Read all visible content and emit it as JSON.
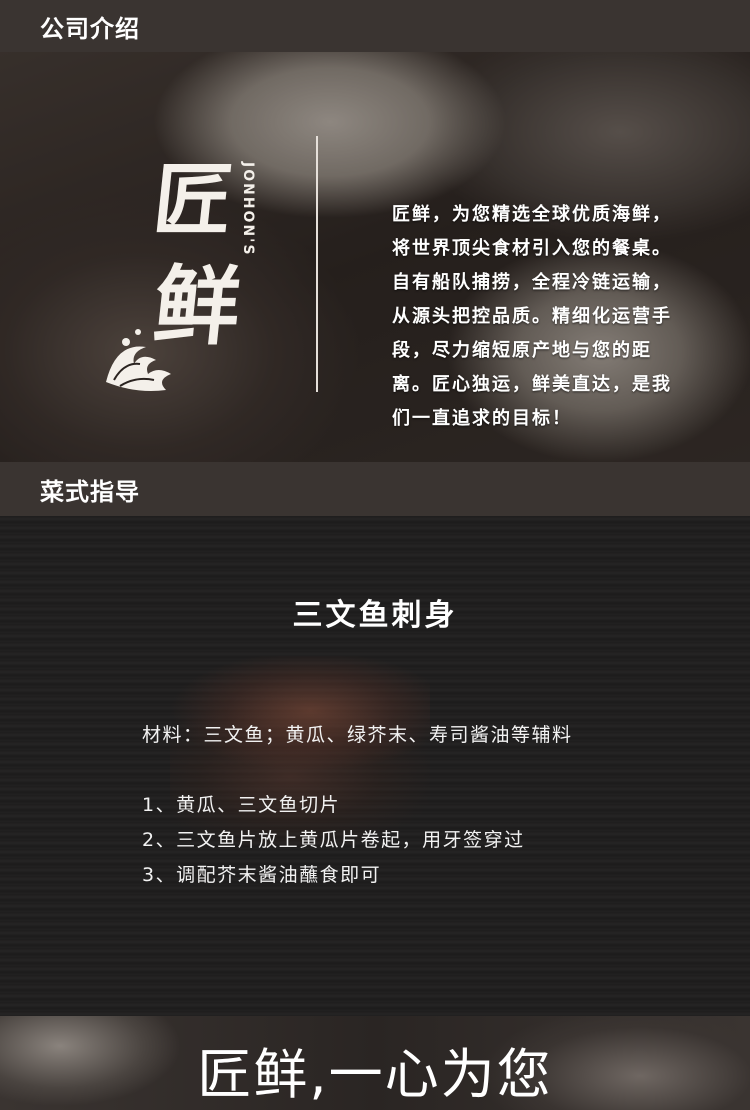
{
  "company_section": {
    "heading": "公司介绍",
    "brand_chars": [
      "匠",
      "鲜"
    ],
    "brand_latin": "JONHON'S",
    "intro_lines": [
      "匠鲜，为您精选全球优质海鲜，",
      "将世界顶尖食材引入您的餐桌。",
      "自有船队捕捞，全程冷链运输，",
      "从源头把控品质。精细化运营手",
      "段，尽力缩短原产地与您的距",
      "离。匠心独运，鲜美直达，是我",
      "们一直追求的目标！"
    ]
  },
  "recipe_section": {
    "heading": "菜式指导",
    "dish_title": "三文鱼刺身",
    "ingredients": "材料：三文鱼；黄瓜、绿芥末、寿司酱油等辅料",
    "steps": [
      "1、黄瓜、三文鱼切片",
      "2、三文鱼片放上黄瓜片卷起，用牙签穿过",
      "3、调配芥末酱油蘸食即可"
    ]
  },
  "footer": {
    "slogan": "匠鲜,一心为您"
  }
}
